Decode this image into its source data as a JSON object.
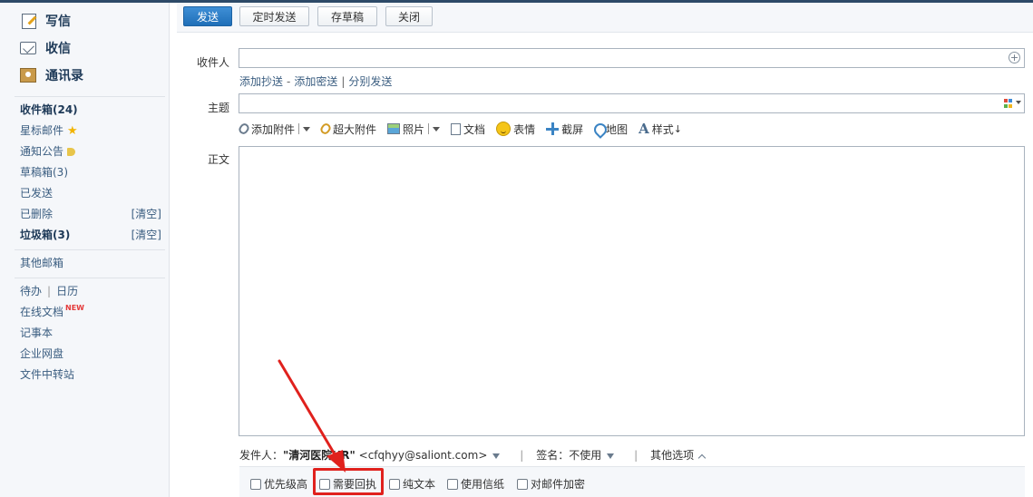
{
  "sidebar": {
    "main_items": [
      {
        "label": "写信",
        "icon": "write-icon"
      },
      {
        "label": "收信",
        "icon": "inbox-icon"
      },
      {
        "label": "通讯录",
        "icon": "contacts-icon"
      }
    ],
    "folders": {
      "inbox": "收件箱(24)",
      "starred": "星标邮件",
      "notice": "通知公告",
      "drafts": "草稿箱(3)",
      "sent": "已发送",
      "deleted": "已删除",
      "spam": "垃圾箱(3)",
      "clear_label": "[清空]"
    },
    "other_mailbox": "其他邮箱",
    "tools": {
      "todo": "待办",
      "calendar": "日历",
      "online_docs": "在线文档",
      "new_tag": "NEW",
      "notebook": "记事本",
      "netdisk": "企业网盘",
      "transfer": "文件中转站"
    }
  },
  "toolbar": {
    "send": "发送",
    "scheduled_send": "定时发送",
    "save_draft": "存草稿",
    "close": "关闭"
  },
  "compose": {
    "to_label": "收件人",
    "to_value": "",
    "add_cc": "添加抄送",
    "dash": "-",
    "add_bcc": "添加密送",
    "pipe": "|",
    "separate_send": "分别发送",
    "subject_label": "主题",
    "subject_value": "",
    "attach": {
      "add_attachment": "添加附件",
      "big_attachment": "超大附件",
      "photo": "照片",
      "document": "文档",
      "emoji": "表情",
      "screenshot": "截屏",
      "map": "地图",
      "style": "样式"
    },
    "body_label": "正文",
    "body_value": ""
  },
  "sender": {
    "label": "发件人：",
    "name": "\"清河医院HR\"",
    "email": "<cfqhyy@saliont.com>",
    "signature": "签名：不使用",
    "other_options": "其他选项"
  },
  "options": {
    "priority": "优先级高",
    "receipt": "需要回执",
    "plain_text": "纯文本",
    "stationery": "使用信纸",
    "encrypt": "对邮件加密"
  },
  "colors": {
    "highlight": "#e0211d",
    "primary_button": "#1f6fb8",
    "link": "#3a5d80"
  }
}
